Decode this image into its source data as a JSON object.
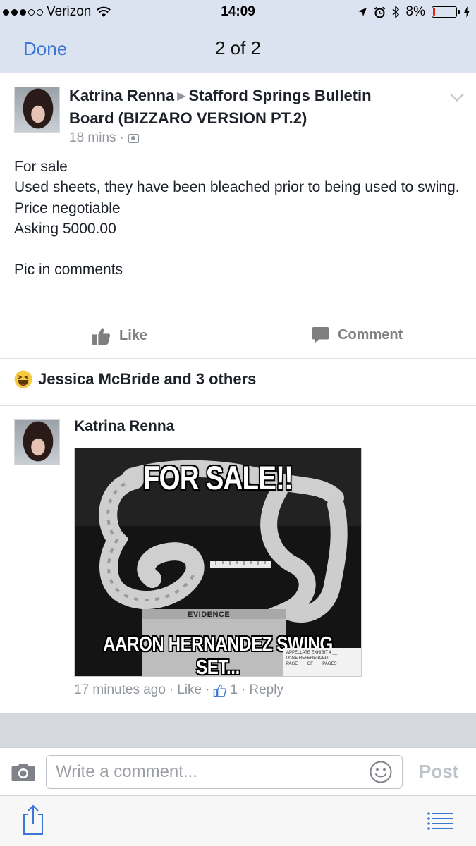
{
  "status_bar": {
    "carrier": "Verizon",
    "time": "14:09",
    "battery_text": "8%",
    "battery_level": 0.08,
    "icons": [
      "signal-dots-icon",
      "wifi-icon",
      "location-arrow-icon",
      "alarm-icon",
      "bluetooth-icon",
      "battery-icon",
      "charging-bolt-icon"
    ]
  },
  "nav": {
    "done_label": "Done",
    "title": "2 of 2"
  },
  "post": {
    "author": "Katrina Renna",
    "group": "Stafford Springs Bulletin Board (BIZZARO VERSION PT.2)",
    "time": "18 mins",
    "separator": "·",
    "body_lines": [
      "For sale",
      "Used sheets, they have  been bleached prior to being used to swing.",
      "Price negotiable",
      "Asking 5000.00",
      "",
      "Pic in comments"
    ],
    "like_label": "Like",
    "comment_label": "Comment",
    "reactions_text": "Jessica McBride and 3 others"
  },
  "comment": {
    "author": "Katrina Renna",
    "image": {
      "top_text": "FOR SALE!!",
      "bottom_text": "AARON HERNANDEZ SWING SET...",
      "evidence_label": "EVIDENCE",
      "sticker_lines": [
        "APPELLATE EXHIBIT 4 __",
        "PAGE REFERENCED:",
        "PAGE ___ OF ___ PAGES"
      ]
    },
    "time": "17 minutes ago",
    "separator": "·",
    "like_label": "Like",
    "like_count": "1",
    "reply_label": "Reply"
  },
  "composer": {
    "placeholder": "Write a comment...",
    "post_label": "Post"
  },
  "colors": {
    "accent": "#3b76d6",
    "nav_bg": "#dce3f0",
    "muted_text": "#90949c",
    "battery_low": "#e0261d"
  }
}
